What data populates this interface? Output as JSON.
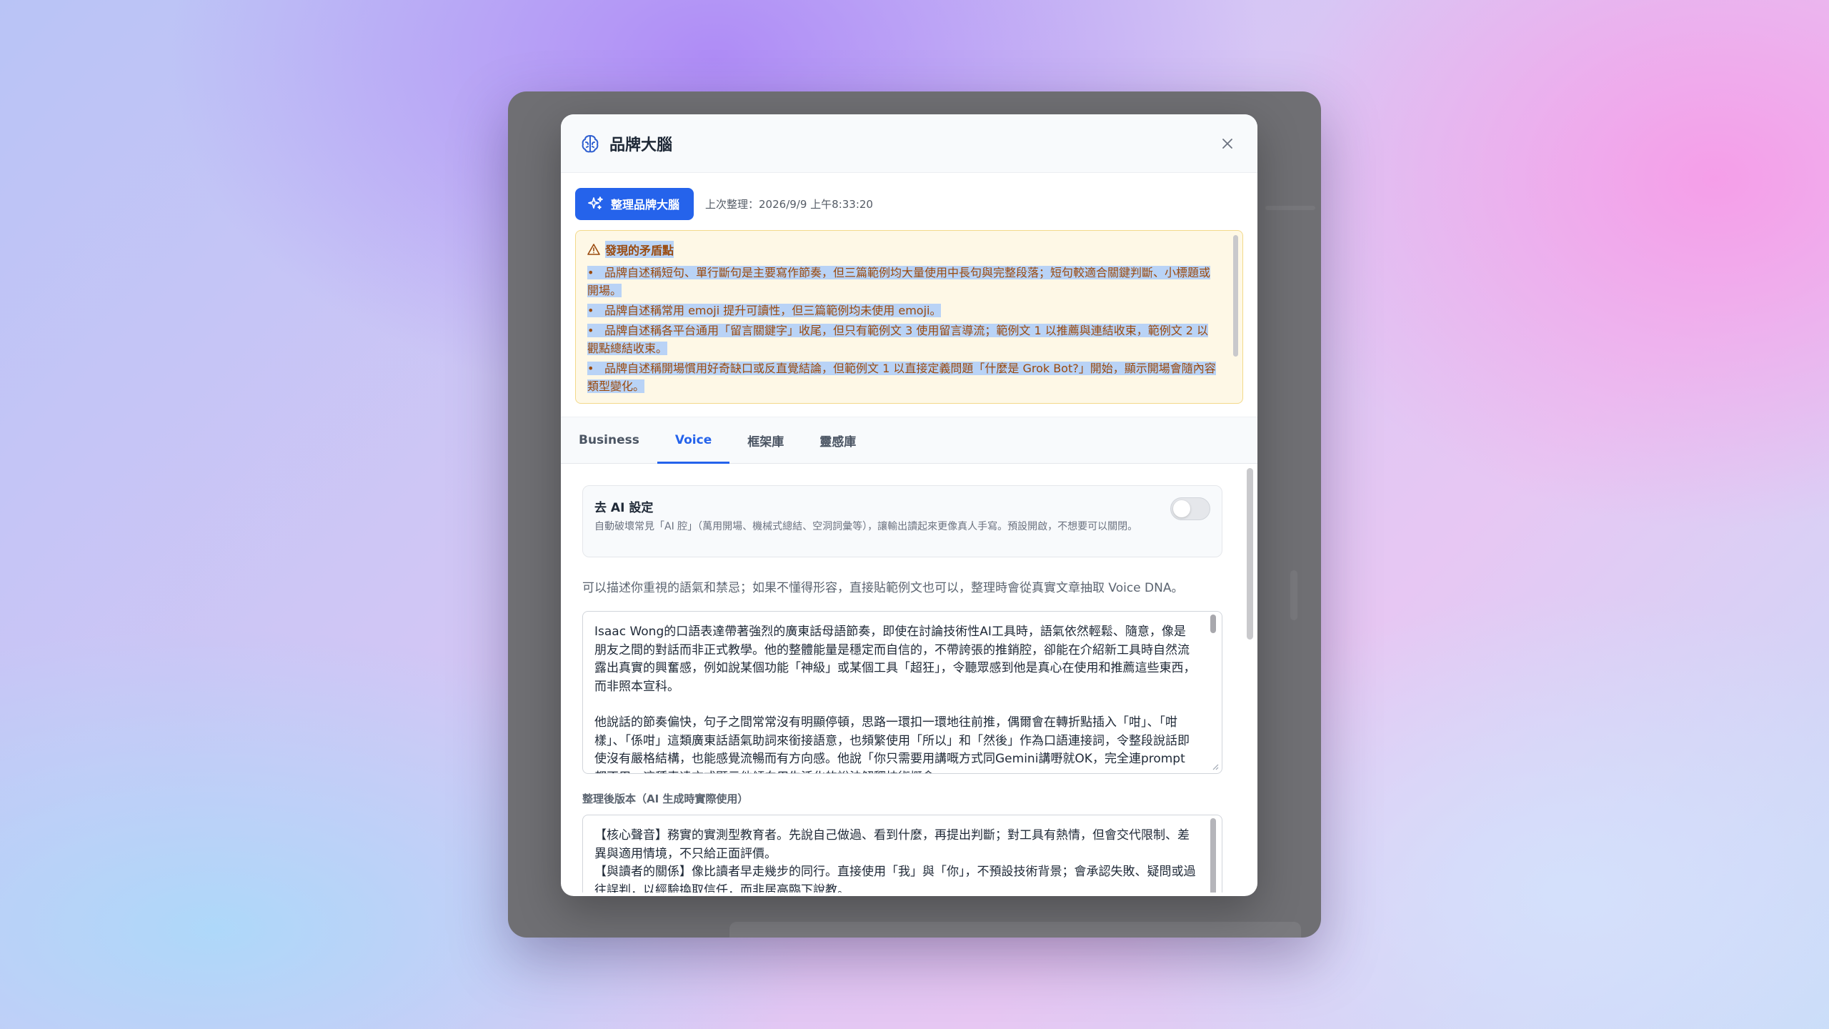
{
  "modal": {
    "title": "品牌大腦",
    "close_label": "×"
  },
  "toolbar": {
    "organize_button": "整理品牌大腦",
    "last_updated": "上次整理：2026/9/9 上午8:33:20"
  },
  "conflicts": {
    "title": "發現的矛盾點",
    "items": [
      "品牌自述稱短句、單行斷句是主要寫作節奏，但三篇範例均大量使用中長句與完整段落；短句較適合關鍵判斷、小標題或開場。",
      "品牌自述稱常用 emoji 提升可讀性，但三篇範例均未使用 emoji。",
      "品牌自述稱各平台通用「留言關鍵字」收尾，但只有範例文 3 使用留言導流；範例文 1 以推薦與連結收束，範例文 2 以觀點總結收束。",
      "品牌自述稱開場慣用好奇缺口或反直覺結論，但範例文 1 以直接定義問題「什麼是 Grok Bot?」開始，顯示開場會隨內容類型變化。"
    ]
  },
  "tabs": [
    {
      "label": "Business",
      "active": false
    },
    {
      "label": "Voice",
      "active": true
    },
    {
      "label": "框架庫",
      "active": false
    },
    {
      "label": "靈感庫",
      "active": false
    }
  ],
  "de_ai": {
    "title": "去 AI 設定",
    "description": "自動破壞常見「AI 腔」（萬用開場、機械式總結、空洞詞彙等），讓輸出讀起來更像真人手寫。預設開啟，不想要可以關閉。",
    "enabled": false
  },
  "voice": {
    "hint": "可以描述你重視的語氣和禁忌；如果不懂得形容，直接貼範例文也可以，整理時會從真實文章抽取 Voice DNA。",
    "paragraphs": [
      "Isaac Wong的口語表達帶著強烈的廣東話母語節奏，即使在討論技術性AI工具時，語氣依然輕鬆、隨意，像是朋友之間的對話而非正式教學。他的整體能量是穩定而自信的，不帶誇張的推銷腔，卻能在介紹新工具時自然流露出真實的興奮感，例如說某個功能「神級」或某個工具「超狂」，令聽眾感到他是真心在使用和推薦這些東西，而非照本宣科。",
      "他說話的節奏偏快，句子之間常常沒有明顯停頓，思路一環扣一環地往前推，偶爾會在轉折點插入「咁」、「咁樣」、「係咁」這類廣東話語氣助詞來銜接語意，也頻繁使用「所以」和「然後」作為口語連接詞，令整段說話即使沒有嚴格結構，也能感覺流暢而有方向感。他說「你只需要用講嘅方式同Gemini講嘢就OK，完全連prompt都不用」這種表達方式顯示他傾向用生活化的說法解釋技術概念。"
    ],
    "processed_label": "整理後版本（AI 生成時實際使用）",
    "processed_text": "【核心聲音】務實的實測型教育者。先說自己做過、看到什麼，再提出判斷；對工具有熱情，但會交代限制、差異與適用情境，不只給正面評價。\n【與讀者的關係】像比讀者早走幾步的同行。直接使用「我」與「你」，不預設技術背景；會承認失敗、疑問或過往誤判，以經驗換取信任，而非居高臨下說教。\n【句長與節奏】中短段、短句為主導的混合節奏；以短判斷帶出關鍵，再以中長句補充脈絡。"
  }
}
